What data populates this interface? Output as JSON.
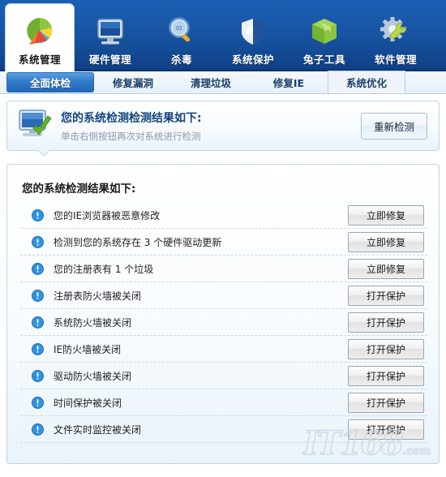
{
  "topnav": {
    "items": [
      {
        "label": "系统管理",
        "icon": "pie-chart-icon",
        "active": true
      },
      {
        "label": "硬件管理",
        "icon": "monitor-icon",
        "active": false
      },
      {
        "label": "杀毒",
        "icon": "magnifier-icon",
        "active": false
      },
      {
        "label": "系统保护",
        "icon": "shield-icon",
        "active": false
      },
      {
        "label": "兔子工具",
        "icon": "green-box-icon",
        "active": false
      },
      {
        "label": "软件管理",
        "icon": "gear-wrench-icon",
        "active": false
      }
    ]
  },
  "subtabs": {
    "items": [
      {
        "label": "全面体检",
        "state": "active"
      },
      {
        "label": "修复漏洞",
        "state": "normal"
      },
      {
        "label": "清理垃圾",
        "state": "normal"
      },
      {
        "label": "修复IE",
        "state": "normal"
      },
      {
        "label": "系统优化",
        "state": "focused"
      }
    ]
  },
  "banner": {
    "icon": "monitor-check-icon",
    "title": "您的系统检测检测结果如下:",
    "subtitle": "单击右侧按钮再次对系统进行检测",
    "button_label": "重新检测"
  },
  "results": {
    "title": "您的系统检测结果如下:",
    "items": [
      {
        "icon": "warning-icon",
        "text": "您的IE浏览器被恶意修改",
        "button": "立即修复"
      },
      {
        "icon": "warning-icon",
        "text": "检测到您的系统存在 3 个硬件驱动更新",
        "button": "立即修复"
      },
      {
        "icon": "warning-icon",
        "text": "您的注册表有 1 个垃圾",
        "button": "立即修复"
      },
      {
        "icon": "warning-icon",
        "text": "注册表防火墙被关闭",
        "button": "打开保护"
      },
      {
        "icon": "warning-icon",
        "text": "系统防火墙被关闭",
        "button": "打开保护"
      },
      {
        "icon": "warning-icon",
        "text": "IE防火墙被关闭",
        "button": "打开保护"
      },
      {
        "icon": "warning-icon",
        "text": "驱动防火墙被关闭",
        "button": "打开保护"
      },
      {
        "icon": "warning-icon",
        "text": "时间保护被关闭",
        "button": "打开保护"
      },
      {
        "icon": "warning-icon",
        "text": "文件实时监控被关闭",
        "button": "打开保护"
      }
    ]
  },
  "watermark": {
    "text": "IT168",
    "suffix": ".com"
  },
  "colors": {
    "nav_blue": "#1a59ab",
    "tab_active": "#3079c8",
    "title_blue": "#12457e",
    "warning_blue": "#2a8bd8"
  }
}
